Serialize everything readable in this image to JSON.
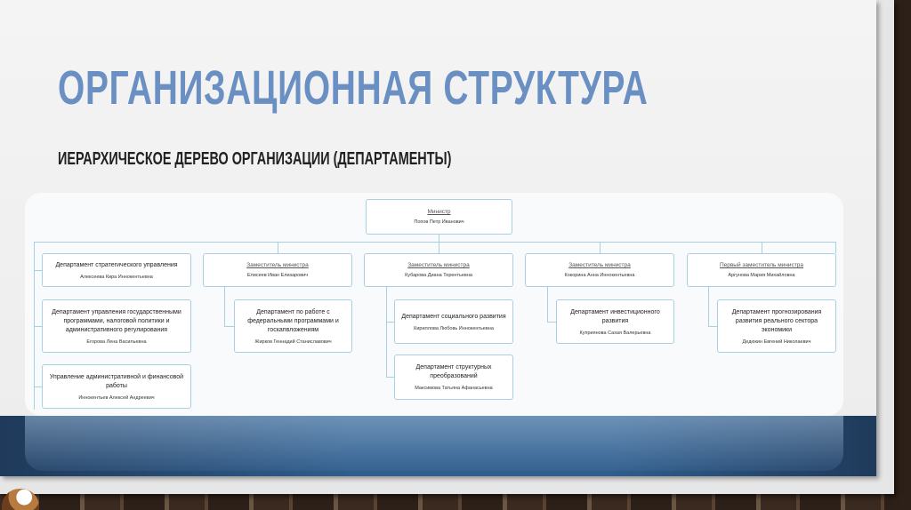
{
  "slide": {
    "title": "ОРГАНИЗАЦИОННАЯ СТРУКТУРА",
    "subtitle": "ИЕРАРХИЧЕСКОЕ ДЕРЕВО ОРГАНИЗАЦИИ (ДЕПАРТАМЕНТЫ)"
  },
  "org": {
    "minister": {
      "role": "Министр",
      "person": "Попов Петр Иванович"
    },
    "columns": [
      {
        "head": {
          "dept": "Департамент стратегического управления",
          "person": "Алексеева Кира Иннокентьевна"
        },
        "children": [
          {
            "dept": "Департамент управления государственными программами, налоговой политики и административного регулирования",
            "person": "Егорова Лена Васильевна"
          },
          {
            "dept": "Управление административной и финансовой работы",
            "person": "Иннокентьев Алексей Андреевич"
          }
        ]
      },
      {
        "head": {
          "role": "Заместитель министра",
          "person": "Елисеев Иван Елизарович"
        },
        "children": [
          {
            "dept": "Департамент по работе с федеральными программами и госкапвложениям",
            "person": "Жирков Геннадий Станиславович"
          }
        ]
      },
      {
        "head": {
          "role": "Заместитель министра",
          "person": "Кубарова Диана Терентьевна"
        },
        "children": [
          {
            "dept": "Департамент социального развития",
            "person": "Кириллова Любовь Иннокентьевна"
          },
          {
            "dept": "Департамент структурных преобразований",
            "person": "Максимова Татьяна Афанасьевна"
          }
        ]
      },
      {
        "head": {
          "role": "Заместитель министра",
          "person": "Кокорина Анна Иннокентьевна"
        },
        "children": [
          {
            "dept": "Департамент инвестиционного развития",
            "person": "Куприянова Сахая Валерьевна"
          }
        ]
      },
      {
        "head": {
          "role": "Первый заместитель министра",
          "person": "Аргунова Мария Михайловна"
        },
        "children": [
          {
            "dept": "Департамент прогнозирования развития реального сектора экономики",
            "person": "Дедюкин Евгений Николаевич"
          }
        ]
      }
    ]
  },
  "colors": {
    "title": "#6a8fc3",
    "connector": "#a9cfe3",
    "band": "#2f5d8c"
  }
}
